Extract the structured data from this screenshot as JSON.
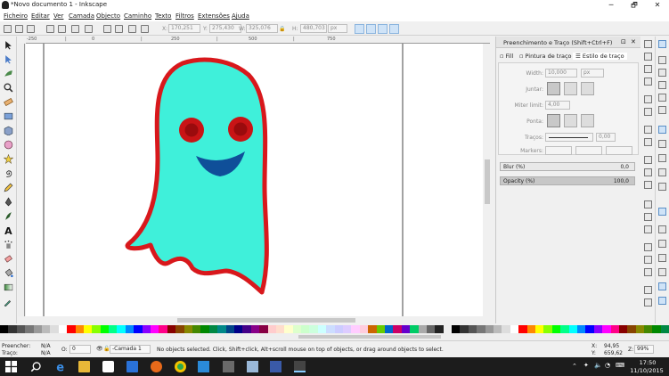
{
  "window": {
    "title": "*Novo documento 1 - Inkscape",
    "controls": [
      "─",
      "🗗",
      "✕"
    ]
  },
  "menu": [
    "Ficheiro",
    "Editar",
    "Ver",
    "Camada",
    "Objecto",
    "Caminho",
    "Texto",
    "Filtros",
    "Extensões",
    "Ajuda"
  ],
  "toolbar": {
    "x_label": "X:",
    "x_value": "170,251",
    "y_label": "Y:",
    "y_value": "275,430",
    "w_label": "W:",
    "w_value": "325,076",
    "h_label": "H:",
    "h_value": "480,703",
    "unit": "px"
  },
  "ruler": {
    "ticks": [
      "-250",
      "|",
      "0",
      "|",
      "250",
      "|",
      "500",
      "|",
      "750"
    ]
  },
  "panel": {
    "title": "Preenchimento e Traço (Shift+Ctrl+F)",
    "tabs": [
      "Fill",
      "Pintura de traço",
      "Estilo de traço"
    ],
    "width_label": "Width:",
    "width_value": "10,000",
    "width_unit": "px",
    "join_label": "Juntar:",
    "miter_label": "Miter limit:",
    "miter_value": "4,00",
    "caps_label": "Ponta:",
    "dashes_label": "Traços:",
    "dashes_value": "0,00",
    "markers_label": "Markers:",
    "blur_label": "Blur (%)",
    "blur_value": "0,0",
    "opacity_label": "Opacity (%)",
    "opacity_value": "100,0"
  },
  "status": {
    "fill_label": "Preencher:",
    "fill_value": "N/A",
    "stroke_label": "Traço:",
    "stroke_value": "N/A",
    "o_label": "O:",
    "o_value": "0",
    "layer": "-Camada 1",
    "message": "No objects selected. Click, Shift+click, Alt+scroll mouse on top of objects, or drag around objects to select.",
    "x_label": "X:",
    "x_value": "94,95",
    "y_label": "Y:",
    "y_value": "659,62",
    "z_label": "Z:",
    "zoom": "99%"
  },
  "taskbar": {
    "time": "17:50",
    "date": "11/10/2015"
  },
  "colors": {
    "ghost_fill": "#3ff0da",
    "ghost_stroke": "#d8181c",
    "eye": "#c81416",
    "pupil": "#9a0b0d",
    "mouth": "#0f4f99"
  }
}
